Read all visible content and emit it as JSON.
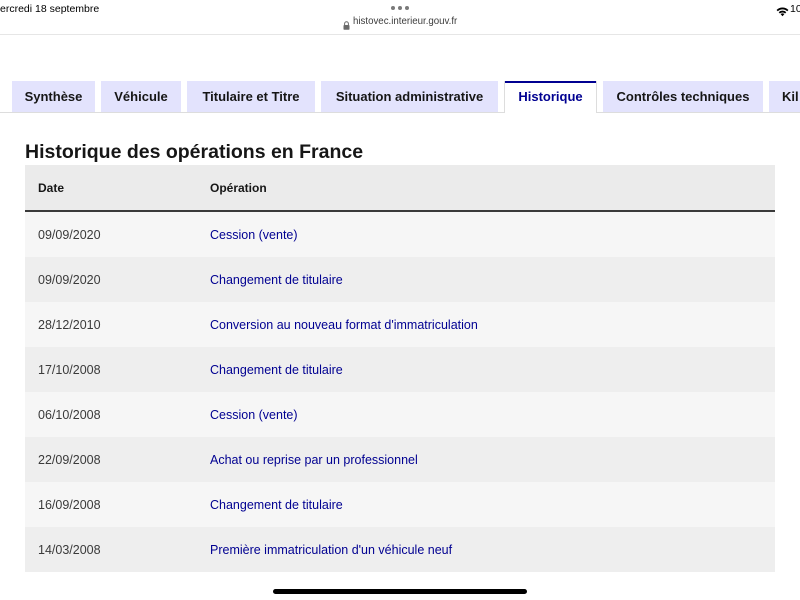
{
  "status_bar": {
    "date": "ercredi 18 septembre",
    "battery": "10",
    "wifi_icon": "wifi-icon"
  },
  "browser": {
    "menu_icon": "more-dots-icon",
    "lock_icon": "lock-icon",
    "url": "histovec.interieur.gouv.fr"
  },
  "tabs": [
    {
      "label": "Synthèse",
      "active": false
    },
    {
      "label": "Véhicule",
      "active": false
    },
    {
      "label": "Titulaire et Titre",
      "active": false
    },
    {
      "label": "Situation administrative",
      "active": false
    },
    {
      "label": "Historique",
      "active": true
    },
    {
      "label": "Contrôles techniques",
      "active": false
    },
    {
      "label": "Kil",
      "active": false
    }
  ],
  "section": {
    "title": "Historique des opérations en France"
  },
  "table": {
    "headers": {
      "date": "Date",
      "operation": "Opération"
    },
    "rows": [
      {
        "date": "09/09/2020",
        "operation": "Cession (vente)"
      },
      {
        "date": "09/09/2020",
        "operation": "Changement de titulaire"
      },
      {
        "date": "28/12/2010",
        "operation": "Conversion au nouveau format d'immatriculation"
      },
      {
        "date": "17/10/2008",
        "operation": "Changement de titulaire"
      },
      {
        "date": "06/10/2008",
        "operation": "Cession (vente)"
      },
      {
        "date": "22/09/2008",
        "operation": "Achat ou reprise par un professionnel"
      },
      {
        "date": "16/09/2008",
        "operation": "Changement de titulaire"
      },
      {
        "date": "14/03/2008",
        "operation": "Première immatriculation d'un véhicule neuf"
      }
    ]
  },
  "colors": {
    "accent": "#000091",
    "tab_background": "#e3e3fd",
    "text": "#161616"
  }
}
